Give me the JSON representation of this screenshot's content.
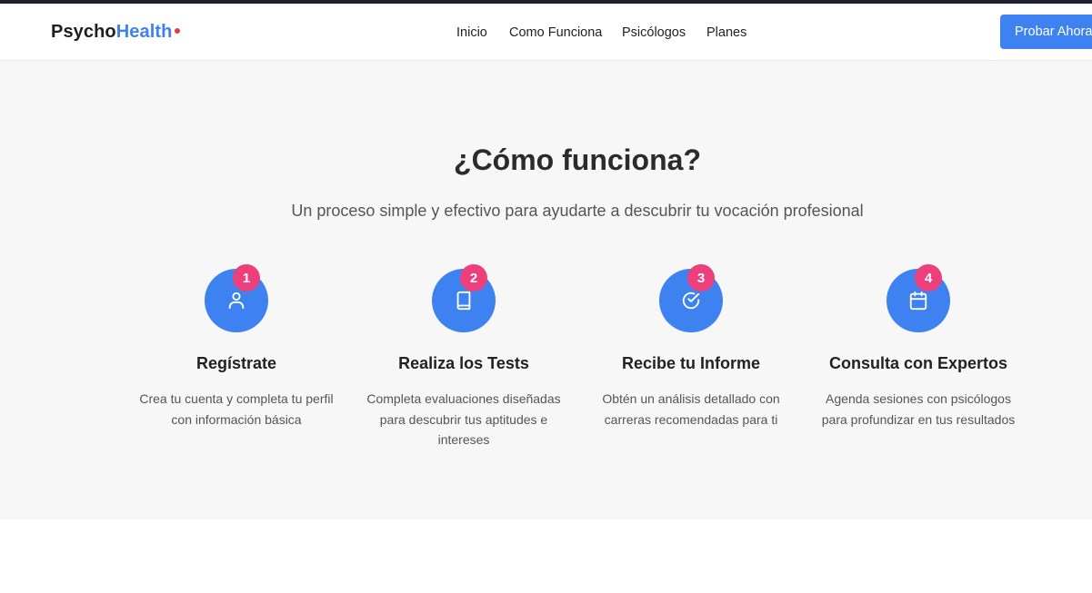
{
  "header": {
    "logo_part1": "Psycho",
    "logo_part2": "Health",
    "nav": [
      "Inicio",
      "Como Funciona",
      "Psicólogos",
      "Planes"
    ],
    "cta_label": "Probar Ahora"
  },
  "section": {
    "title": "¿Cómo funciona?",
    "subtitle": "Un proceso simple y efectivo para ayudarte a descubrir tu vocación profesional",
    "steps": [
      {
        "number": "1",
        "icon": "user-icon",
        "title": "Regístrate",
        "description": "Crea tu cuenta y completa tu perfil con información básica"
      },
      {
        "number": "2",
        "icon": "book-icon",
        "title": "Realiza los Tests",
        "description": "Completa evaluaciones diseñadas para descubrir tus aptitudes e intereses"
      },
      {
        "number": "3",
        "icon": "check-circle-icon",
        "title": "Recibe tu Informe",
        "description": "Obtén un análisis detallado con carreras recomendadas para ti"
      },
      {
        "number": "4",
        "icon": "calendar-icon",
        "title": "Consulta con Expertos",
        "description": "Agenda sesiones con psicólogos para profundizar en tus resultados"
      }
    ]
  },
  "colors": {
    "brand_blue": "#3d82f0",
    "badge_pink": "#ee3f7d",
    "logo_dot": "#e53950",
    "section_bg": "#f7f7f7"
  }
}
